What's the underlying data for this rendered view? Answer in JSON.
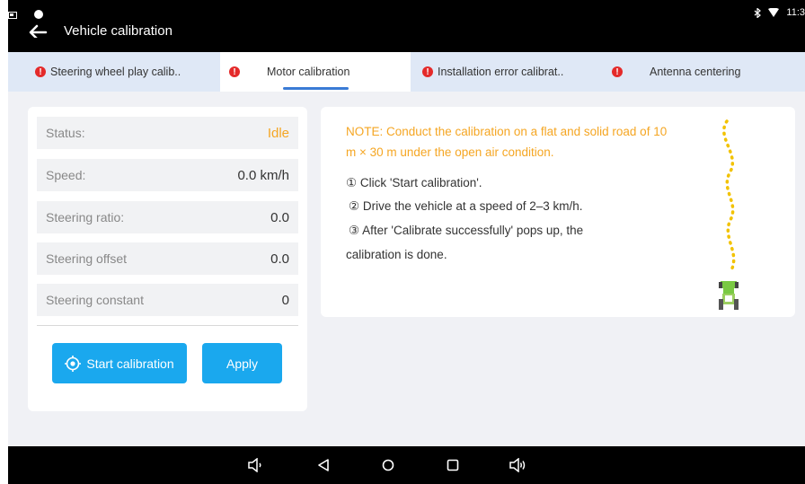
{
  "titlebar": {
    "title": "Vehicle calibration",
    "time": "11:3",
    "icons": [
      "back-arrow-icon",
      "notification-icon",
      "bluetooth-icon",
      "wifi-icon"
    ]
  },
  "tabs": [
    {
      "label": "Steering wheel play calib..",
      "error": true,
      "active": false
    },
    {
      "label": "Motor calibration",
      "error": true,
      "active": true
    },
    {
      "label": "Installation error calibrat..",
      "error": true,
      "active": false
    },
    {
      "label": "Antenna centering",
      "error": true,
      "active": false
    }
  ],
  "status_rows": [
    {
      "label": "Status:",
      "value": "Idle"
    },
    {
      "label": "Speed:",
      "value": "0.0 km/h"
    },
    {
      "label": "Steering ratio:",
      "value": "0.0"
    },
    {
      "label": "Steering offset",
      "value": "0.0"
    },
    {
      "label": "Steering constant",
      "value": "0"
    }
  ],
  "buttons": {
    "start_label": "Start calibration",
    "apply_label": "Apply"
  },
  "instructions": {
    "note": "NOTE: Conduct the calibration on a flat and solid road of 10 m × 30 m under the open air condition.",
    "step1": "① Click 'Start calibration'.",
    "step2": "② Drive the vehicle at a speed of 2–3 km/h.",
    "step3_line1": "③ After 'Calibrate successfully' pops up, the",
    "step3_line2": "calibration is done."
  },
  "colors": {
    "accent": "#1aa8ee",
    "warning": "#f5a623",
    "error": "#e42a2a",
    "tab_bg": "#dfe8f6"
  },
  "navbar": {
    "icons": [
      "volume-down-icon",
      "back-icon",
      "home-icon",
      "recents-icon",
      "volume-up-icon"
    ]
  }
}
